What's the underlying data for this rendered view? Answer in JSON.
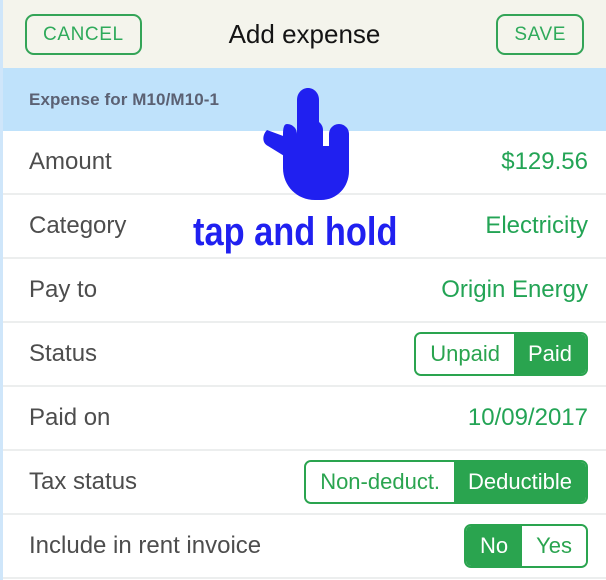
{
  "appbar": {
    "cancel_label": "CANCEL",
    "title": "Add expense",
    "save_label": "SAVE"
  },
  "section": {
    "header": "Expense for M10/M10-1"
  },
  "rows": [
    {
      "label": "Amount",
      "value": "$129.56"
    },
    {
      "label": "Category",
      "value": "Electricity"
    },
    {
      "label": "Pay to",
      "value": "Origin Energy"
    },
    {
      "label": "Status",
      "options": [
        "Unpaid",
        "Paid"
      ],
      "selected": 1
    },
    {
      "label": "Paid on",
      "value": "10/09/2017"
    },
    {
      "label": "Tax status",
      "options": [
        "Non-deduct.",
        "Deductible"
      ],
      "selected": 1
    },
    {
      "label": "Include in rent invoice",
      "options": [
        "No",
        "Yes"
      ],
      "selected": 0
    }
  ],
  "overlay": {
    "gesture_text": "tap and hold",
    "cursor_icon": "hand-pointer-icon"
  },
  "colors": {
    "accent_green": "#2aa44f",
    "value_green": "#23a455",
    "appbar_bg": "#f4f4ec",
    "section_bg": "#bfe2fb",
    "section_text": "#5b6173",
    "label_gray": "#4d4d4d",
    "overlay_blue": "#2020f0",
    "divider": "#eceeee"
  }
}
